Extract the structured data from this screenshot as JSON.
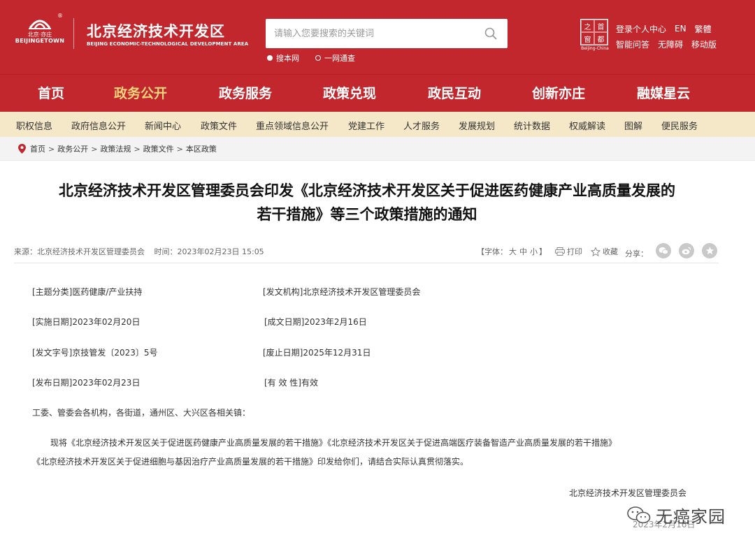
{
  "header": {
    "logo_cn": "北京·亦庄",
    "logo_en": "BEIJINGETOWN",
    "logo_reg": "®",
    "site_title_cn": "北京经济技术开发区",
    "site_title_en": "BEIJING ECONOMIC-TECHNOLOGICAL DEVELOPMENT AREA",
    "search_placeholder": "请输入您要搜索的关键词",
    "scope_site": "搜本网",
    "scope_all": "一网通查",
    "capital_logo_chars": [
      "之",
      "首",
      "窗",
      "都"
    ],
    "capital_logo_en": "Beijing-China",
    "links_row1": [
      "登录个人中心",
      "EN",
      "繁體"
    ],
    "links_row2": [
      "智能问答",
      "无障碍",
      "移动版"
    ]
  },
  "mainnav": {
    "items": [
      "首页",
      "政务公开",
      "政务服务",
      "政策兑现",
      "政民互动",
      "创新亦庄",
      "融媒星云"
    ],
    "active_index": 1,
    "active_color": "#f4d37d"
  },
  "subnav": {
    "items": [
      "职权信息",
      "政府信息公开",
      "新闻中心",
      "政策文件",
      "重点领域信息公开",
      "党建工作",
      "人才服务",
      "发展规划",
      "统计数据",
      "权威解读",
      "图解",
      "便民服务"
    ]
  },
  "breadcrumb": {
    "items": [
      "首页",
      "政务公开",
      "政策法规",
      "政策文件",
      "本区政策"
    ],
    "separator": ">"
  },
  "article": {
    "title_line1": "北京经济技术开发区管理委员会印发《北京经济技术开发区关于促进医药健康产业高质量发展的",
    "title_line2": "若干措施》等三个政策措施的通知",
    "source": "来源：北京经济技术开发区管理委员会",
    "time": "时间：2023年02月23日 15:05",
    "font_label": "【字体：",
    "font_big": "大",
    "font_mid": "中",
    "font_small": "小",
    "font_end": "】",
    "print_label": "打印",
    "fav_label": "收藏",
    "share_label": "分享：",
    "share_icons": [
      "wechat-icon",
      "weibo-icon",
      "star-share-icon"
    ],
    "info": {
      "category": "[主题分类]医药健康/产业扶持",
      "issuer": "[发文机构]北京经济技术开发区管理委员会",
      "impl_date": "[实施日期]2023年02月20日",
      "made_date": "[成文日期]2023年2月16日",
      "doc_no": "[发文字号]京技管发〔2023〕5号",
      "expire_date": "[废止日期]2025年12月31日",
      "pub_date": "[发布日期]2023年02月23日",
      "validity": "[有 效 性]有效"
    },
    "addressee": "工委、管委会各机构，各街道，通州区、大兴区各相关镇：",
    "para_line1": "现将《北京经济技术开发区关于促进医药健康产业高质量发展的若干措施》《北京经济技术开发区关于促进高端医疗装备智造产业高质量发展的若干措施》",
    "para_line2": "《北京经济技术开发区关于促进细胞与基因治疗产业高质量发展的若干措施》印发给你们，请结合实际认真贯彻落实。",
    "signature": "北京经济技术开发区管理委员会",
    "sign_date": "2023年2月16日"
  },
  "watermark": {
    "text": "无癌家园",
    "icon": "wechat-icon"
  },
  "colors": {
    "brand_red": "#c1272d",
    "subnav_bg": "#f5e8c9"
  }
}
